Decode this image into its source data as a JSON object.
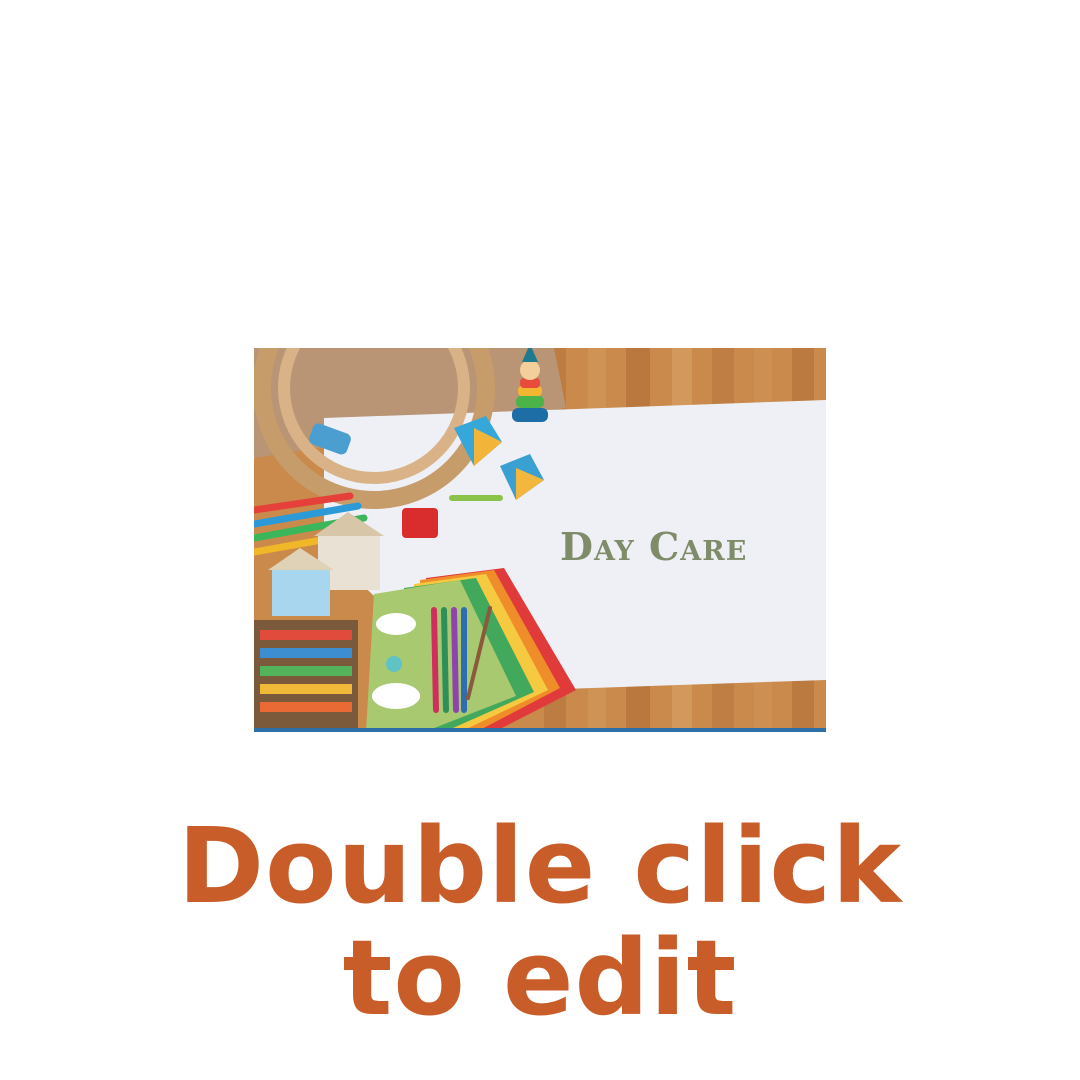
{
  "image": {
    "title": "Day Care"
  },
  "headline": {
    "line1": "Double click",
    "line2": "to edit"
  },
  "colors": {
    "headline": "#c85d2a",
    "title": "#7f8c6a",
    "floor": "#c9874a",
    "paper": "#eef0f6"
  }
}
